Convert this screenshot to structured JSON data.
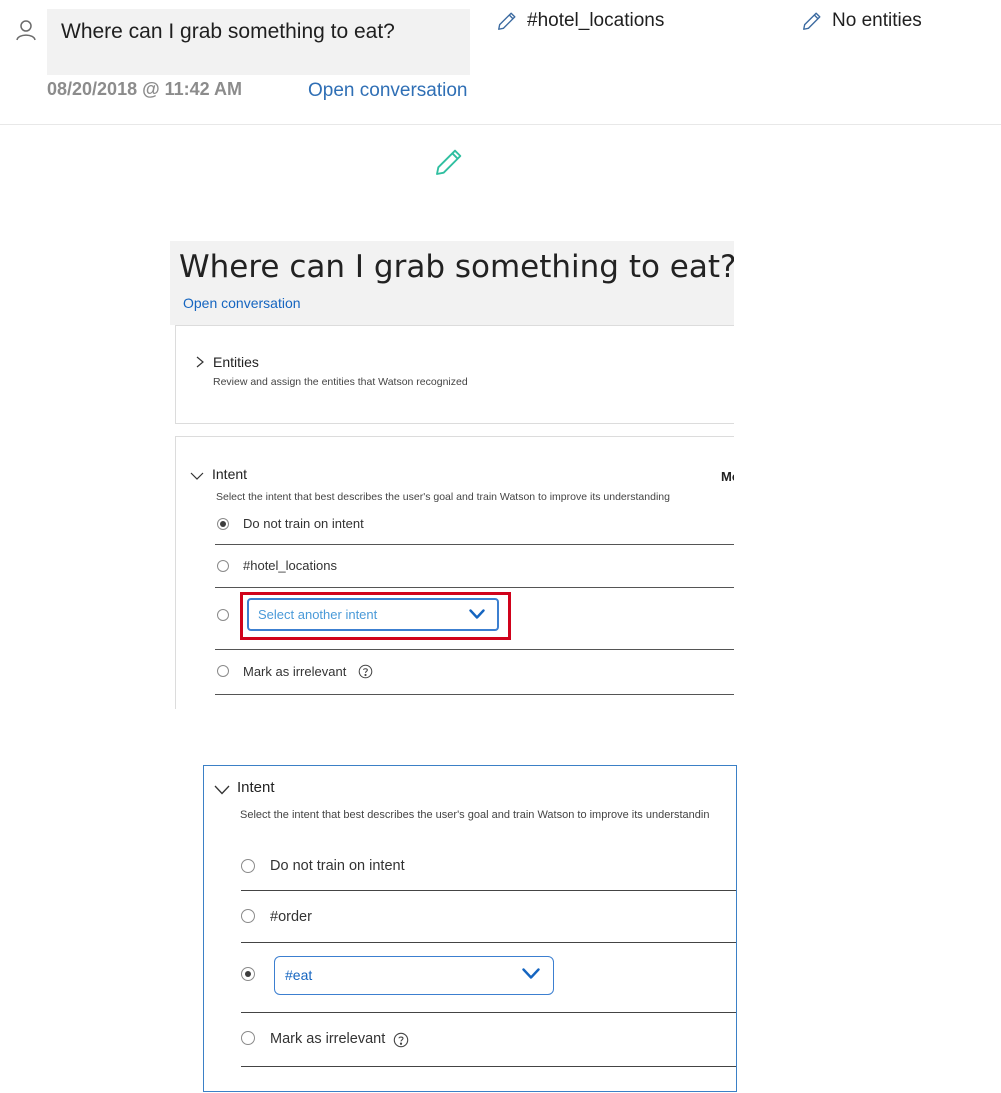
{
  "top": {
    "message": "Where can I grab something to eat?",
    "timestamp": "08/20/2018 @ 11:42 AM",
    "open_conversation": "Open conversation",
    "intent_tag": "#hotel_locations",
    "entities_tag": "No entities",
    "icons": [
      "user-icon",
      "pencil-icon"
    ]
  },
  "panel1": {
    "title": "Where can I grab something to eat?",
    "open_conversation": "Open conversation",
    "entities": {
      "title": "Entities",
      "description": "Review and assign the entities that Watson recognized"
    },
    "intent": {
      "title": "Intent",
      "description": "Select the intent that best describes the user's goal and train Watson to improve its understanding",
      "more_label": "Mo",
      "options": [
        {
          "label": "Do not train on intent",
          "selected": true
        },
        {
          "label": "#hotel_locations",
          "selected": false
        },
        {
          "label": "Select another intent",
          "selected": false,
          "type": "dropdown"
        },
        {
          "label": "Mark as irrelevant",
          "selected": false,
          "help": true
        }
      ]
    },
    "highlight_color": "#d0021b"
  },
  "panel2": {
    "intent": {
      "title": "Intent",
      "description": "Select the intent that best describes the user's goal and train Watson to improve its understandin",
      "options": [
        {
          "label": "Do not train on intent",
          "selected": false
        },
        {
          "label": "#order",
          "selected": false
        },
        {
          "label": "#eat",
          "selected": true,
          "type": "dropdown"
        },
        {
          "label": "Mark as irrelevant",
          "selected": false,
          "help": true
        }
      ]
    },
    "border_color": "#3b80c6"
  }
}
